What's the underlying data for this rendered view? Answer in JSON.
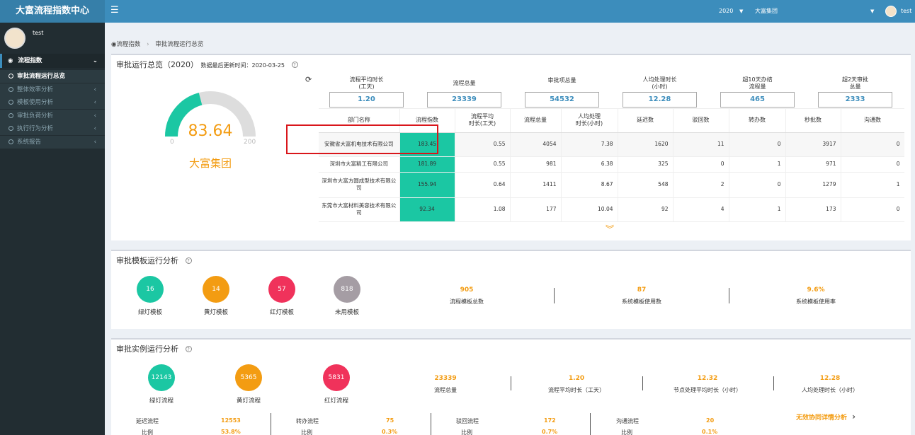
{
  "app": {
    "title": "大富流程指数中心",
    "menu_icon": "hamburger-icon"
  },
  "topbar": {
    "year": "2020",
    "year_caret": "▼",
    "group": "大富集团",
    "group_caret": "▼",
    "user": "test"
  },
  "sidebar": {
    "user": "test",
    "root": {
      "label": "流程指数",
      "icon": "dashboard-icon",
      "caret": "⌄"
    },
    "items": [
      {
        "label": "审批流程运行总览",
        "active": true
      },
      {
        "label": "整体效率分析",
        "arrow": "‹"
      },
      {
        "label": "模板使用分析",
        "arrow": "‹"
      },
      {
        "label": "审批负荷分析",
        "arrow": "‹"
      },
      {
        "label": "执行行为分析",
        "arrow": "‹"
      },
      {
        "label": "系统报告",
        "arrow": "‹"
      }
    ]
  },
  "breadcrumb": {
    "home": "流程指数",
    "sep": "›",
    "current": "审批流程运行总览"
  },
  "overview": {
    "title": "审批运行总览（2020）",
    "update_label": "数据最后更新时间：2020-03-25",
    "help": "?",
    "refresh": "⟳",
    "gauge": {
      "value": "83.64",
      "min": "0",
      "max": "200",
      "name": "大富集团",
      "fraction": 0.4182,
      "fill_color": "#1bc7a3",
      "track_color": "#dddddd"
    },
    "stats": [
      {
        "label1": "流程平均时长",
        "label2": "(工天)",
        "value": "1.20"
      },
      {
        "label1": "流程总量",
        "label2": "",
        "value": "23339"
      },
      {
        "label1": "审批项总量",
        "label2": "",
        "value": "54532"
      },
      {
        "label1": "人均处理时长",
        "label2": "(小时)",
        "value": "12.28"
      },
      {
        "label1": "超10天办结",
        "label2": "流程量",
        "value": "465"
      },
      {
        "label1": "超2天审批",
        "label2": "总量",
        "value": "2333"
      }
    ],
    "table": {
      "headers": [
        "部门名称",
        "流程指数",
        "流程平均|时长(工天)",
        "流程总量",
        "人均处理|时长(小时)",
        "延迟数",
        "驳回数",
        "转办数",
        "秒批数",
        "沟通数"
      ],
      "rows": [
        [
          "安徽省大富机电技术有限公司",
          "183.45",
          "0.55",
          "4054",
          "7.38",
          "1620",
          "11",
          "0",
          "3917",
          "0"
        ],
        [
          "深圳市大富精工有限公司",
          "181.89",
          "0.55",
          "981",
          "6.38",
          "325",
          "0",
          "1",
          "971",
          "0"
        ],
        [
          "深圳市大富方圆成型技术有限公司",
          "155.94",
          "0.64",
          "1411",
          "8.67",
          "548",
          "2",
          "0",
          "1279",
          "1"
        ],
        [
          "东莞市大富材料美容技术有限公司",
          "92.34",
          "1.08",
          "177",
          "10.04",
          "92",
          "4",
          "1",
          "173",
          "0"
        ]
      ]
    },
    "expand_icon": "︾"
  },
  "templates": {
    "title": "审批模板运行分析",
    "help": "?",
    "circles": [
      {
        "value": "16",
        "label": "绿灯模板",
        "color": "#1bc7a3"
      },
      {
        "value": "14",
        "label": "黄灯模板",
        "color": "#f39c12"
      },
      {
        "value": "57",
        "label": "红灯模板",
        "color": "#f0325b"
      },
      {
        "value": "818",
        "label": "未用模板",
        "color": "#a59da4"
      }
    ],
    "stats": [
      {
        "value": "905",
        "label": "流程模板总数"
      },
      {
        "value": "87",
        "label": "系统模板使用数"
      },
      {
        "value": "9.6%",
        "label": "系统模板使用率"
      }
    ]
  },
  "instances": {
    "title": "审批实例运行分析",
    "help": "?",
    "circles": [
      {
        "value": "12143",
        "label": "绿灯流程",
        "color": "#1bc7a3"
      },
      {
        "value": "5365",
        "label": "黄灯流程",
        "color": "#f39c12"
      },
      {
        "value": "5831",
        "label": "红灯流程",
        "color": "#f0325b"
      }
    ],
    "stats": [
      {
        "value": "23339",
        "label": "流程总量"
      },
      {
        "value": "1.20",
        "label": "流程平均时长（工天）"
      },
      {
        "value": "12.32",
        "label": "节点处理平均时长（小时）"
      },
      {
        "value": "12.28",
        "label": "人均处理时长（小时）"
      }
    ],
    "detail_link": "无效协同详情分析",
    "detail_arrow": "›",
    "bottom": [
      {
        "name": "延迟流程",
        "value": "12553",
        "ratio_label": "比例",
        "ratio": "53.8%"
      },
      {
        "name": "转办流程",
        "value": "75",
        "ratio_label": "比例",
        "ratio": "0.3%"
      },
      {
        "name": "驳回流程",
        "value": "172",
        "ratio_label": "比例",
        "ratio": "0.7%"
      },
      {
        "name": "沟通流程",
        "value": "20",
        "ratio_label": "比例",
        "ratio": "0.1%"
      }
    ]
  }
}
